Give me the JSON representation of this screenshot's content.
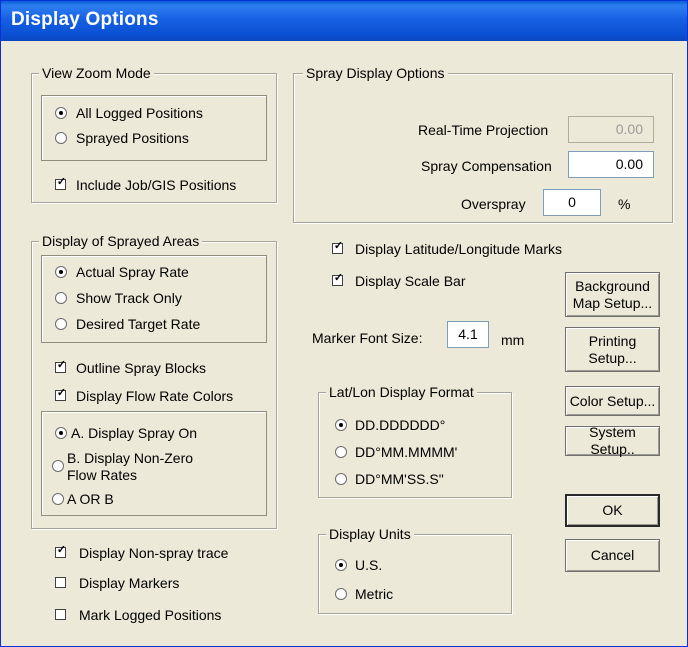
{
  "window": {
    "title": "Display Options"
  },
  "view_zoom": {
    "legend": "View Zoom Mode",
    "radios": [
      {
        "label": "All Logged Positions",
        "checked": true
      },
      {
        "label": "Sprayed Positions",
        "checked": false
      }
    ],
    "include_job": {
      "label": "Include Job/GIS Positions",
      "checked": true
    }
  },
  "spray_display": {
    "legend": "Spray Display Options",
    "realtime_label": "Real-Time Projection",
    "realtime_value": "0.00",
    "compensation_label": "Spray Compensation",
    "compensation_value": "0.00",
    "overspray_label": "Overspray",
    "overspray_value": "0",
    "overspray_unit": "%"
  },
  "sprayed_areas": {
    "legend": "Display of Sprayed Areas",
    "rate_radios": [
      {
        "label": "Actual Spray Rate",
        "checked": true
      },
      {
        "label": "Show Track Only",
        "checked": false
      },
      {
        "label": "Desired Target Rate",
        "checked": false
      }
    ],
    "outline": {
      "label": "Outline Spray Blocks",
      "checked": true
    },
    "flow_colors": {
      "label": "Display Flow Rate Colors",
      "checked": true
    },
    "mode_radios": [
      {
        "label": "A.  Display Spray On",
        "checked": true
      },
      {
        "label_line1": "B.  Display Non-Zero",
        "label_line2": "Flow Rates",
        "checked": false
      },
      {
        "label": "A OR B",
        "checked": false
      }
    ]
  },
  "bottom_checks": {
    "non_spray": {
      "label": "Display Non-spray trace",
      "checked": true
    },
    "markers": {
      "label": "Display Markers",
      "checked": false
    },
    "mark_logged": {
      "label": "Mark Logged Positions",
      "checked": false
    }
  },
  "middle": {
    "latlon_marks": {
      "label": "Display Latitude/Longitude Marks",
      "checked": true
    },
    "scale_bar": {
      "label": "Display Scale Bar",
      "checked": true
    },
    "marker_font_label": "Marker Font Size:",
    "marker_font_value": "4.1",
    "marker_font_unit": "mm"
  },
  "latlon_format": {
    "legend": "Lat/Lon Display Format",
    "radios": [
      {
        "label": "DD.DDDDDD°",
        "checked": true
      },
      {
        "label": "DD°MM.MMMM'",
        "checked": false
      },
      {
        "label": "DD°MM'SS.S\"",
        "checked": false
      }
    ]
  },
  "display_units": {
    "legend": "Display Units",
    "radios": [
      {
        "label": "U.S.",
        "checked": true
      },
      {
        "label": "Metric",
        "checked": false
      }
    ]
  },
  "buttons": {
    "background_map_1": "Background",
    "background_map_2": "Map Setup...",
    "printing_1": "Printing",
    "printing_2": "Setup...",
    "color": "Color Setup...",
    "system": "System Setup..",
    "ok": "OK",
    "cancel": "Cancel"
  }
}
